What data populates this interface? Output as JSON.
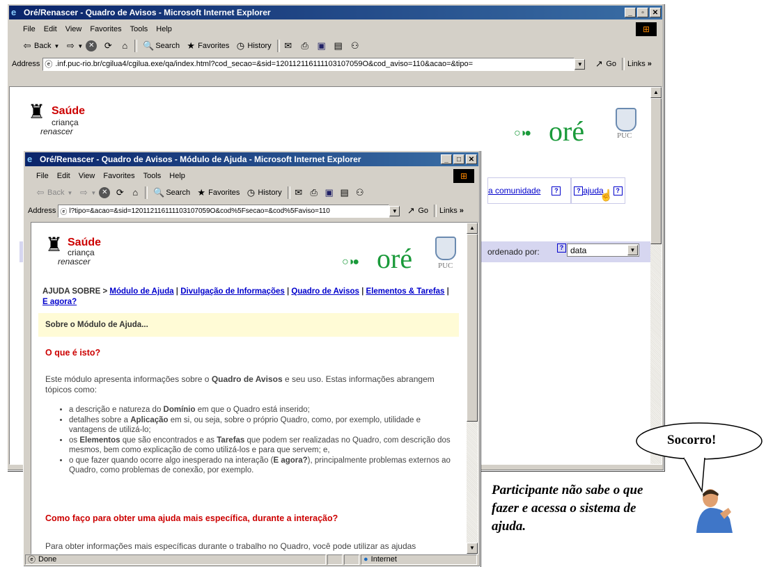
{
  "main_window": {
    "title": "Oré/Renascer - Quadro de Avisos - Microsoft Internet Explorer",
    "menu": [
      "File",
      "Edit",
      "View",
      "Favorites",
      "Tools",
      "Help"
    ],
    "toolbar": {
      "back": "Back",
      "search": "Search",
      "favorites": "Favorites",
      "history": "History"
    },
    "address_label": "Address",
    "address_url": ".inf.puc-rio.br/cgilua4/cgilua.exe/qa/index.html?cod_secao=&sid=120112116111103107059O&cod_aviso=110&acao=&tipo=",
    "go": "Go",
    "links": "Links",
    "links_chevron": "»",
    "nav_community": "a comunidade",
    "nav_help": "ajuda",
    "ordered_by": "ordenado por:",
    "sort_value": "data"
  },
  "help_window": {
    "title": "Oré/Renascer - Quadro de Avisos - Módulo de Ajuda - Microsoft Internet Explorer",
    "menu": [
      "File",
      "Edit",
      "View",
      "Favorites",
      "Tools",
      "Help"
    ],
    "toolbar": {
      "back": "Back",
      "search": "Search",
      "favorites": "Favorites",
      "history": "History"
    },
    "address_label": "Address",
    "address_url": "l?tipo=&acao=&sid=120112116111103107059O&cod%5Fsecao=&cod%5Faviso=110",
    "go": "Go",
    "links": "Links",
    "links_chevron": "»",
    "breadcrumb_prefix": "AJUDA SOBRE >",
    "breadcrumb_links": [
      "Módulo de Ajuda",
      "Divulgação de Informações",
      "Quadro de Avisos",
      "Elementos & Tarefas",
      "E agora?"
    ],
    "section_banner": "Sobre o Módulo de Ajuda...",
    "heading1": "O que é isto?",
    "intro_before": "Este módulo apresenta informações sobre o ",
    "intro_bold": "Quadro de Avisos",
    "intro_after": " e seu uso. Estas informações abrangem tópicos como:",
    "bullets": [
      {
        "a": "a descrição e natureza do ",
        "b": "Domínio",
        "c": " em que o Quadro está inserido;"
      },
      {
        "a": "detalhes sobre a ",
        "b": "Aplicação",
        "c": " em si, ou seja, sobre o próprio Quadro, como, por exemplo, utilidade e vantagens de utilizá-lo;"
      },
      {
        "a": "os ",
        "b": "Elementos",
        "c": " que são encontrados e as ",
        "d": "Tarefas",
        "e": " que podem ser realizadas no Quadro, com descrição dos mesmos, bem como explicação de como utilizá-los e para que servem; e,"
      },
      {
        "a": "o que fazer quando ocorre algo inesperado na interação (",
        "b": "E agora?",
        "c": "), principalmente problemas externos ao Quadro, como problemas de conexão, por exemplo."
      }
    ],
    "heading2": "Como faço para obter uma ajuda mais específica, durante a interação?",
    "para2": "Para obter informações mais específicas durante o trabalho no Quadro, você pode utilizar as ajudas",
    "status_done": "Done",
    "status_zone": "Internet"
  },
  "logo": {
    "saude": "Saúde",
    "crianca": "criança",
    "renascer": "renascer",
    "ore": "oré",
    "puc": "PUC"
  },
  "annotation": {
    "bubble": "Socorro!",
    "caption": "Participante não sabe o que fazer e acessa o sistema de ajuda."
  }
}
